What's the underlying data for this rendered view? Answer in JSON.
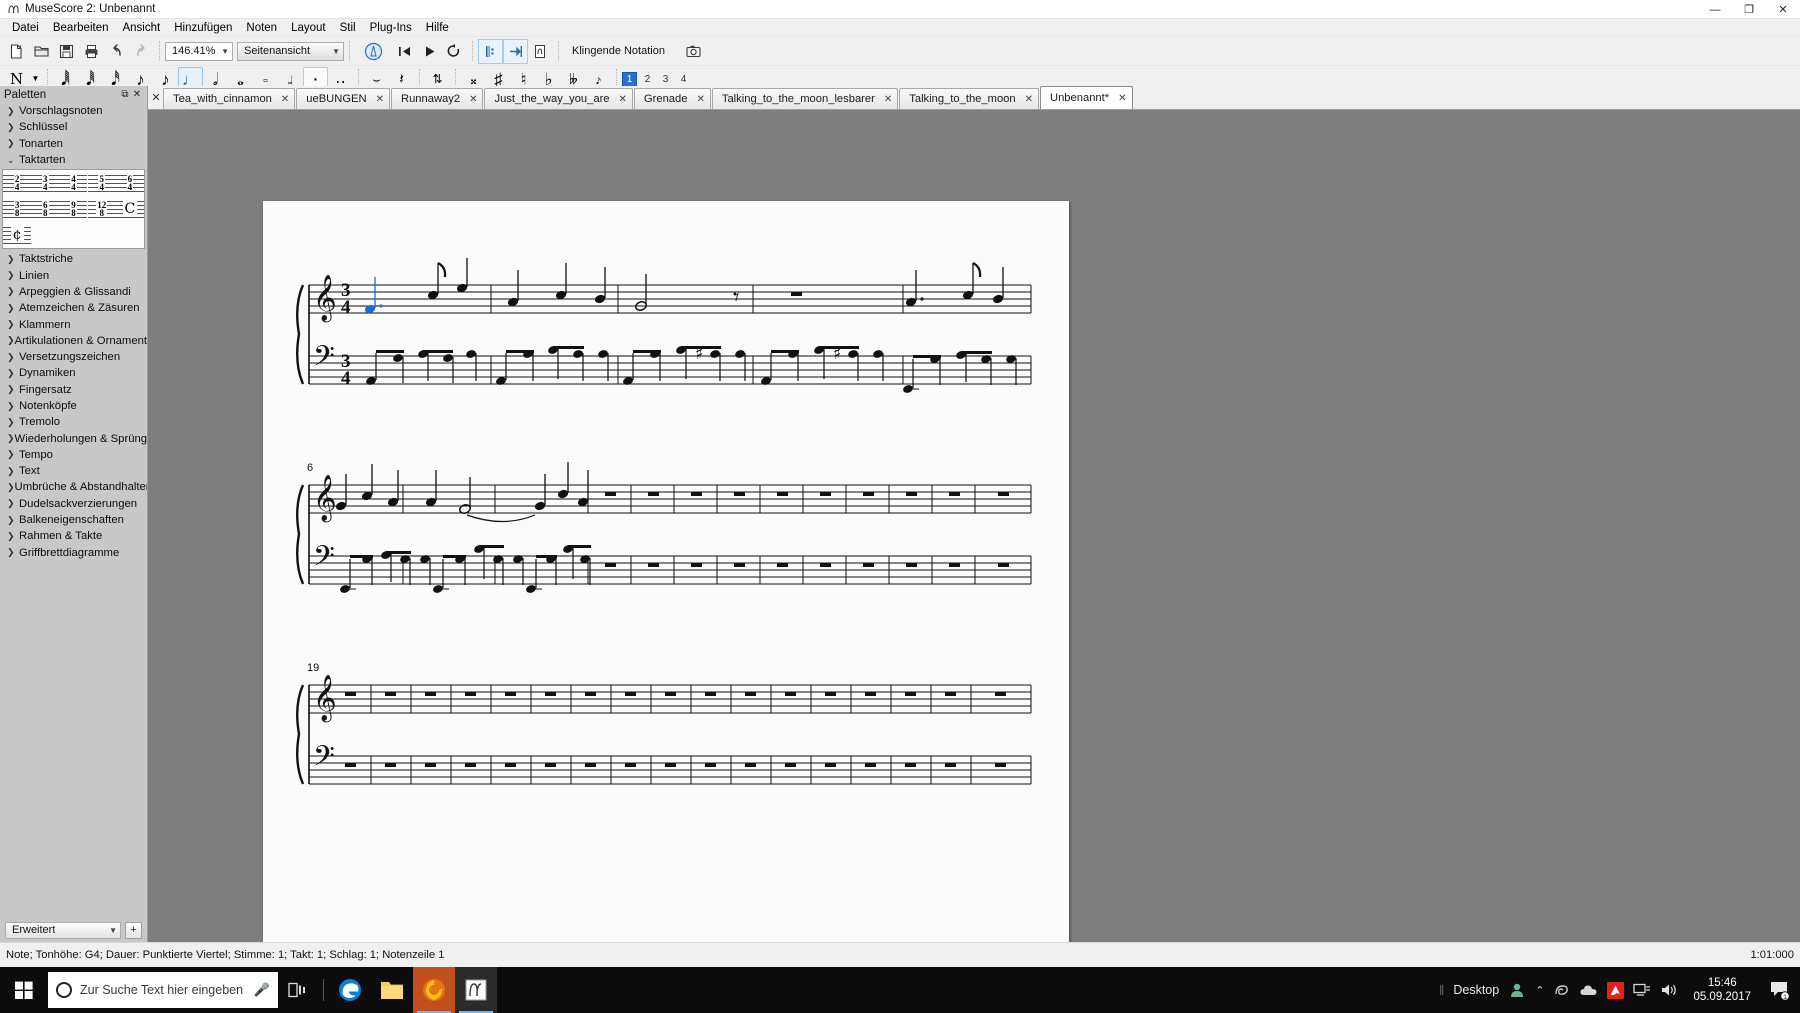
{
  "window": {
    "title": "MuseScore 2: Unbenannt",
    "icon": "musescore-icon",
    "minimize": "—",
    "maximize": "❐",
    "close": "✕"
  },
  "menubar": {
    "items": [
      {
        "label": "Datei",
        "name": "menu-datei"
      },
      {
        "label": "Bearbeiten",
        "name": "menu-bearbeiten"
      },
      {
        "label": "Ansicht",
        "name": "menu-ansicht"
      },
      {
        "label": "Hinzufügen",
        "name": "menu-hinzufuegen"
      },
      {
        "label": "Noten",
        "name": "menu-noten"
      },
      {
        "label": "Layout",
        "name": "menu-layout"
      },
      {
        "label": "Stil",
        "name": "menu-stil"
      },
      {
        "label": "Plug-Ins",
        "name": "menu-pluginss"
      },
      {
        "label": "Hilfe",
        "name": "menu-hilfe"
      }
    ]
  },
  "toolbar": {
    "new_icon": "new-score-icon",
    "open_icon": "open-folder-icon",
    "save_icon": "save-icon",
    "print_icon": "print-icon",
    "undo_icon": "undo-icon",
    "redo_icon": "redo-icon",
    "zoom_value": "146.41%",
    "view_value": "Seitenansicht",
    "metronome_icon": "metronome-icon",
    "rewind_icon": "rewind-icon",
    "play_icon": "play-icon",
    "loop_icon": "loop-icon",
    "play_repeats_icon": "play-repeats-icon",
    "pan_score_icon": "pan-score-icon",
    "midi_icon": "midi-input-icon",
    "concert_pitch_label": "Klingende Notation",
    "image_capture_icon": "image-capture-icon"
  },
  "notes_toolbar": {
    "note_entry_icon": "note-input-icon",
    "dropdown_icon": "chevron-down-icon",
    "durations": [
      {
        "name": "duration-64th",
        "glyph": "♫"
      },
      {
        "name": "duration-32nd",
        "glyph": "♫"
      },
      {
        "name": "duration-16th",
        "glyph": "♫"
      },
      {
        "name": "duration-8th",
        "glyph": "♪"
      },
      {
        "name": "duration-quarter",
        "glyph": "♩",
        "selected": true
      },
      {
        "name": "duration-half",
        "glyph": "♩"
      },
      {
        "name": "duration-whole",
        "glyph": "○"
      },
      {
        "name": "duration-breve",
        "glyph": "○"
      },
      {
        "name": "duration-longa",
        "glyph": "○"
      }
    ],
    "dot_icon": "augmentation-dot-icon",
    "double_dot_icon": "double-dot-icon",
    "tie_icon": "tie-icon",
    "rest_icon": "rest-icon",
    "flip_icon": "flip-direction-icon",
    "accidentals": [
      {
        "name": "accidental-double-sharp",
        "glyph": "×"
      },
      {
        "name": "accidental-sharp",
        "glyph": "♯"
      },
      {
        "name": "accidental-natural",
        "glyph": "♮"
      },
      {
        "name": "accidental-flat",
        "glyph": "♭"
      },
      {
        "name": "accidental-double-flat",
        "glyph": "♭♭"
      }
    ],
    "grace_note_icon": "grace-note-icon",
    "voices": [
      {
        "label": "1",
        "active": true
      },
      {
        "label": "2",
        "active": false
      },
      {
        "label": "3",
        "active": false
      },
      {
        "label": "4",
        "active": false
      }
    ]
  },
  "palette": {
    "title": "Paletten",
    "undock_icon": "undock-icon",
    "close_icon": "close-icon",
    "items": [
      {
        "label": "Vorschlagsnoten",
        "open": false
      },
      {
        "label": "Schlüssel",
        "open": false
      },
      {
        "label": "Tonarten",
        "open": false
      },
      {
        "label": "Taktarten",
        "open": true
      },
      {
        "label": "Taktstriche",
        "open": false
      },
      {
        "label": "Linien",
        "open": false
      },
      {
        "label": "Arpeggien & Glissandi",
        "open": false
      },
      {
        "label": "Atemzeichen & Zäsuren",
        "open": false
      },
      {
        "label": "Klammern",
        "open": false
      },
      {
        "label": "Artikulationen & Ornamente",
        "open": false
      },
      {
        "label": "Versetzungszeichen",
        "open": false
      },
      {
        "label": "Dynamiken",
        "open": false
      },
      {
        "label": "Fingersatz",
        "open": false
      },
      {
        "label": "Notenköpfe",
        "open": false
      },
      {
        "label": "Tremolo",
        "open": false
      },
      {
        "label": "Wiederholungen & Sprünge",
        "open": false
      },
      {
        "label": "Tempo",
        "open": false
      },
      {
        "label": "Text",
        "open": false
      },
      {
        "label": "Umbrüche & Abstandhalter",
        "open": false
      },
      {
        "label": "Dudelsackverzierungen",
        "open": false
      },
      {
        "label": "Balkeneigenschaften",
        "open": false
      },
      {
        "label": "Rahmen & Takte",
        "open": false
      },
      {
        "label": "Griffbrettdiagramme",
        "open": false
      }
    ],
    "timesig_cells": [
      {
        "top": "2",
        "bottom": "4",
        "name": "timesig-2-4"
      },
      {
        "top": "3",
        "bottom": "4",
        "name": "timesig-3-4"
      },
      {
        "top": "4",
        "bottom": "4",
        "name": "timesig-4-4"
      },
      {
        "top": "5",
        "bottom": "4",
        "name": "timesig-5-4"
      },
      {
        "top": "6",
        "bottom": "4",
        "name": "timesig-6-4"
      },
      {
        "top": "3",
        "bottom": "8",
        "name": "timesig-3-8"
      },
      {
        "top": "6",
        "bottom": "8",
        "name": "timesig-6-8"
      },
      {
        "top": "9",
        "bottom": "8",
        "name": "timesig-9-8"
      },
      {
        "top": "12",
        "bottom": "8",
        "name": "timesig-12-8"
      },
      {
        "glyph": "ᴓ4",
        "name": "timesig-common"
      },
      {
        "glyph": "ᴓ5",
        "name": "timesig-cut"
      }
    ],
    "mode_value": "Erweitert",
    "add_label": "+"
  },
  "tabs": {
    "close_all_icon": "close-icon",
    "items": [
      {
        "label": "Tea_with_cinnamon",
        "active": false
      },
      {
        "label": "ueBUNGEN",
        "active": false
      },
      {
        "label": "Runnaway2",
        "active": false
      },
      {
        "label": "Just_the_way_you_are",
        "active": false
      },
      {
        "label": "Grenade",
        "active": false
      },
      {
        "label": "Talking_to_the_moon_lesbarer",
        "active": false
      },
      {
        "label": "Talking_to_the_moon",
        "active": false
      },
      {
        "label": "Unbenannt*",
        "active": true
      }
    ],
    "close_glyph": "✕"
  },
  "score": {
    "systems": [
      {
        "measure_number": "",
        "show_number": false
      },
      {
        "measure_number": "6",
        "show_number": true
      },
      {
        "measure_number": "19",
        "show_number": true
      }
    ],
    "time_signature": {
      "top": "3",
      "bottom": "4"
    },
    "treble_clef": "𝄞",
    "bass_clef": "𝄢",
    "selected_note": {
      "color": "#1a6fd4",
      "pitch": "G4",
      "duration": "Punktierte Viertel"
    }
  },
  "statusbar": {
    "text": "Note; Tonhöhe: G4; Dauer: Punktierte Viertel; Stimme: 1;  Takt: 1; Schlag: 1; Notenzeile 1",
    "right_text": "1:01:000"
  },
  "taskbar": {
    "start_icon": "windows-start-icon",
    "search_placeholder": "Zur Suche Text hier eingeben",
    "cortana_icon": "cortana-circle-icon",
    "mic_icon": "microphone-icon",
    "taskview_icon": "task-view-icon",
    "apps": [
      {
        "name": "edge-icon",
        "running": false
      },
      {
        "name": "file-explorer-icon",
        "running": false
      },
      {
        "name": "firefox-icon",
        "running": true
      },
      {
        "name": "musescore-icon",
        "running": true
      }
    ],
    "tray": {
      "desktop_label": "Desktop",
      "people_icon": "people-icon",
      "overflow_icon": "chevron-up-icon",
      "items": [
        "nvidia-icon",
        "onedrive-icon",
        "avira-icon",
        "network-icon",
        "volume-icon"
      ],
      "time": "15:46",
      "date": "05.09.2017",
      "notifications_icon": "action-center-icon",
      "notifications_count": "1"
    }
  }
}
